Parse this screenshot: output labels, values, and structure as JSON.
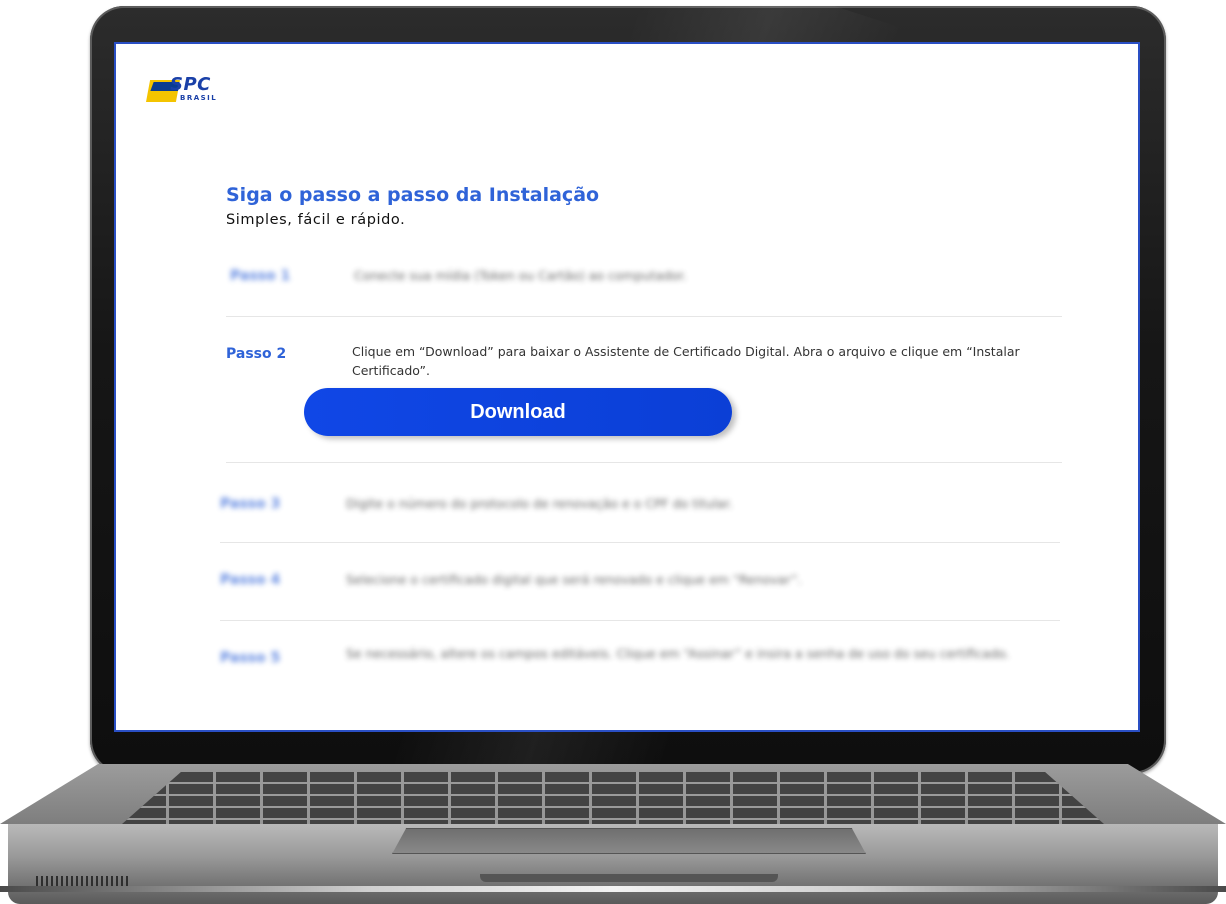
{
  "brand": {
    "logo_text": "SPC",
    "logo_sub": "BRASIL"
  },
  "header": {
    "title": "Siga o passo a passo da Instalação",
    "subtitle": "Simples, fácil e rápido."
  },
  "steps": [
    {
      "label": "Passo 1",
      "text": "Conecte sua mídia (Token ou Cartão) ao computador."
    },
    {
      "label": "Passo 2",
      "text": "Clique em “Download” para baixar o Assistente de Certificado Digital. Abra o arquivo e clique em “Instalar Certificado”."
    },
    {
      "label": "Passo 3",
      "text": "Digite o número do protocolo de renovação e o CPF do titular."
    },
    {
      "label": "Passo 4",
      "text": "Selecione o certificado digital que será renovado e clique em “Renovar”."
    },
    {
      "label": "Passo 5",
      "text": "Se necessário, altere os campos editáveis. Clique em “Assinar” e insira a senha de uso do seu certificado."
    }
  ],
  "download_button": {
    "label": "Download"
  },
  "colors": {
    "accent": "#2f63d8",
    "button": "#0b3fd6",
    "logo_yellow": "#f4c400"
  }
}
